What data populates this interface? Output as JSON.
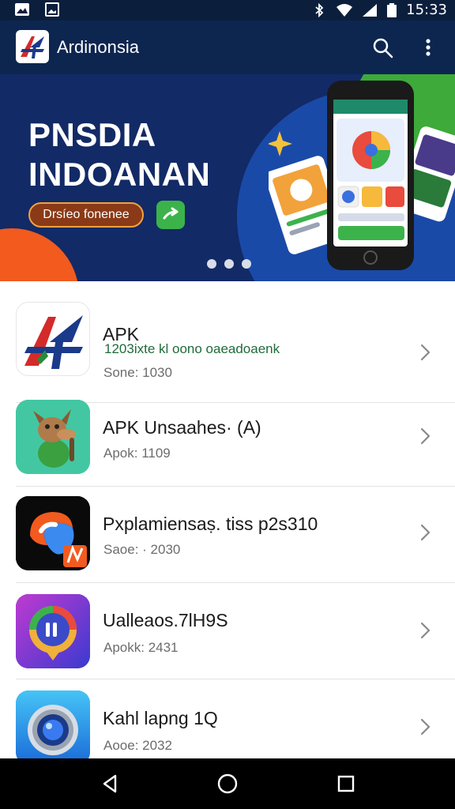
{
  "status_bar": {
    "time": "15:33",
    "icons": [
      "gallery-icon",
      "image-icon",
      "bluetooth-icon",
      "wifi-icon",
      "signal-icon",
      "battery-icon"
    ]
  },
  "app_bar": {
    "title": "Ardinonsia",
    "icons": [
      "search-icon",
      "more-vert-icon"
    ]
  },
  "banner": {
    "title_line1": "PNSDIA",
    "title_line2": "INDOANAN",
    "cta_label": "Drsíeo fonenee",
    "go_icon": "arrow-forward-icon",
    "page_count": 3,
    "colors": {
      "background": "#122a66",
      "accent_orange": "#f25a1e",
      "accent_green": "#3daa3a"
    }
  },
  "apps": [
    {
      "name": "APK",
      "subtitle": "1203ixte kl oono oaeadoaenk",
      "meta": "Sone: 1030",
      "icon": "ap-logo-icon"
    },
    {
      "name": "APK Unsaahes· (A)",
      "subtitle": "",
      "meta": "Apok: 1109",
      "icon": "dog-character-icon"
    },
    {
      "name": "Pxplamiensaṣ. tiss p2s310",
      "subtitle": "",
      "meta": "Saoe: · 2030",
      "icon": "n-swirl-icon"
    },
    {
      "name": "Ualleaos.7lH9S",
      "subtitle": "",
      "meta": "Apokk: 2431",
      "icon": "chat-bubble-icon"
    },
    {
      "name": "Kahl lapng 1Q",
      "subtitle": "",
      "meta": "Aooe: 2032",
      "icon": "camera-lens-icon"
    }
  ],
  "nav_bar": {
    "buttons": [
      "back-icon",
      "home-icon",
      "recents-icon"
    ]
  }
}
